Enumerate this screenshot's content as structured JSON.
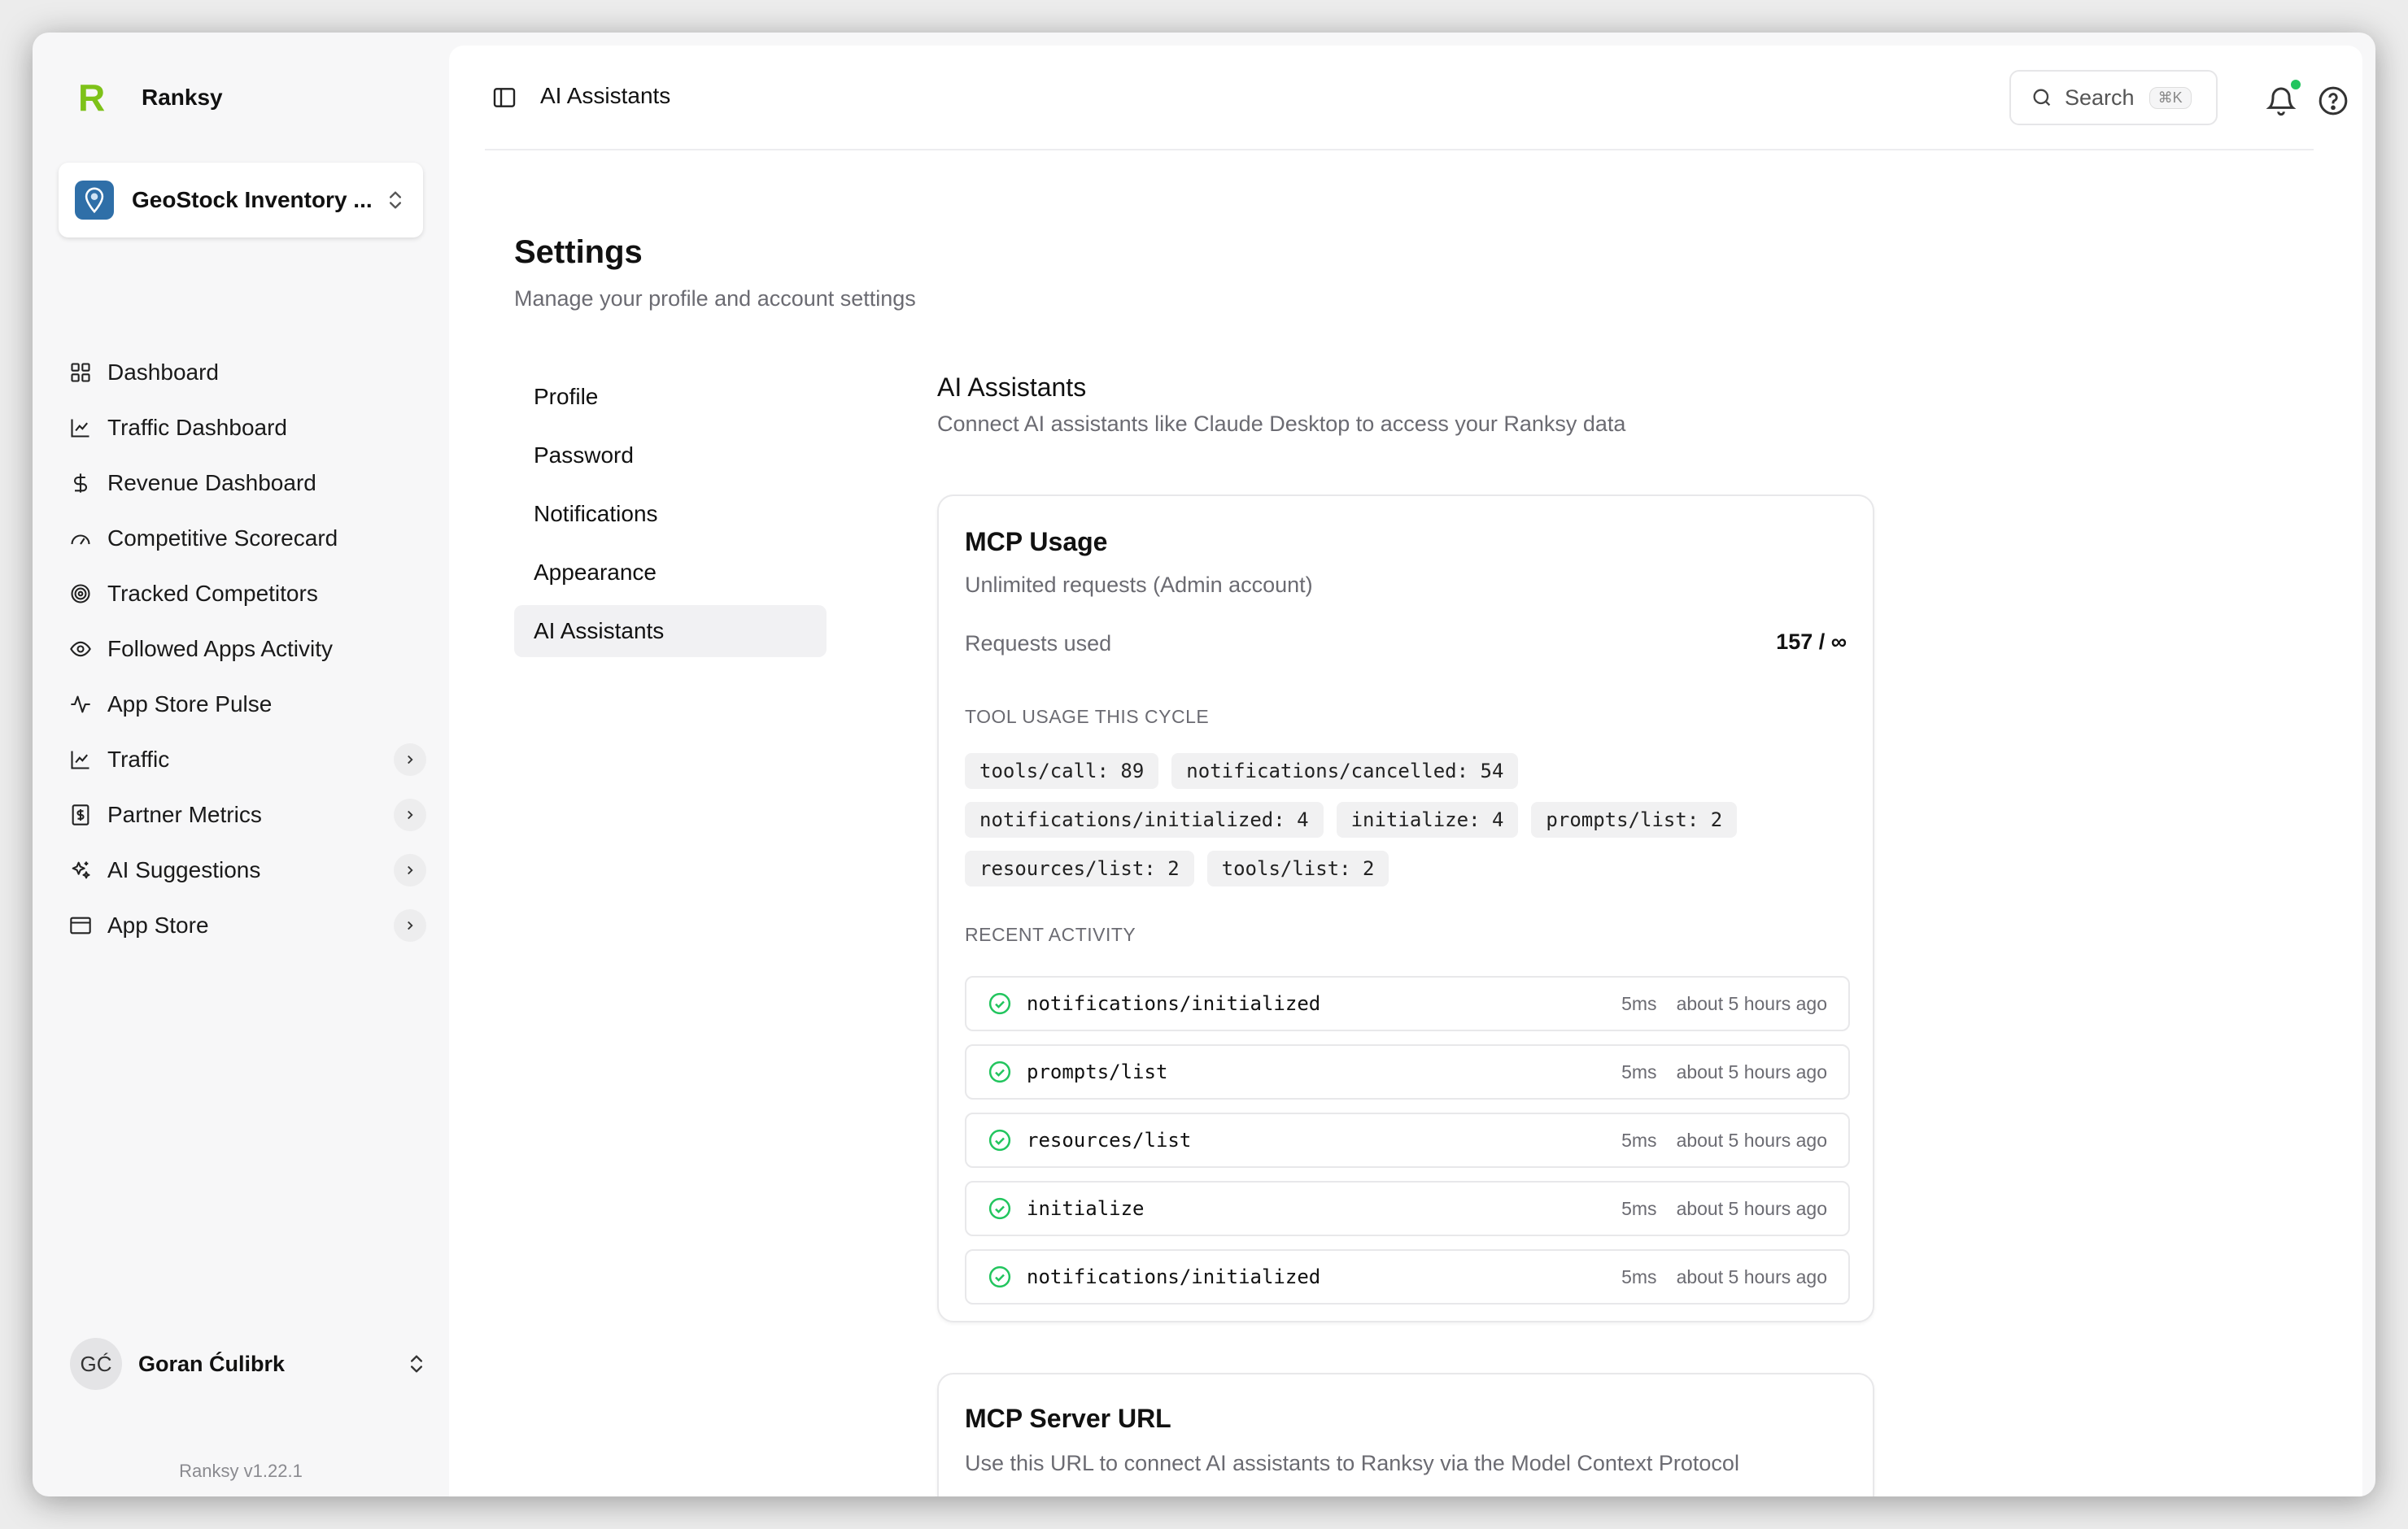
{
  "brand": {
    "name": "Ranksy",
    "logo_letter": "R"
  },
  "workspace": {
    "name": "GeoStock Inventory ..."
  },
  "nav": {
    "items": [
      {
        "label": "Dashboard",
        "icon": "grid-icon"
      },
      {
        "label": "Traffic Dashboard",
        "icon": "line-chart-icon"
      },
      {
        "label": "Revenue Dashboard",
        "icon": "dollar-icon"
      },
      {
        "label": "Competitive Scorecard",
        "icon": "gauge-icon"
      },
      {
        "label": "Tracked Competitors",
        "icon": "target-icon"
      },
      {
        "label": "Followed Apps Activity",
        "icon": "eye-icon"
      },
      {
        "label": "App Store Pulse",
        "icon": "pulse-icon"
      },
      {
        "label": "Traffic",
        "icon": "line-chart-icon",
        "expandable": true
      },
      {
        "label": "Partner Metrics",
        "icon": "dollar-square-icon",
        "expandable": true
      },
      {
        "label": "AI Suggestions",
        "icon": "sparkles-icon",
        "expandable": true
      },
      {
        "label": "App Store",
        "icon": "browser-icon",
        "expandable": true
      }
    ]
  },
  "user": {
    "initials": "GĆ",
    "name": "Goran Ćulibrk"
  },
  "version": "Ranksy  v1.22.1",
  "topbar": {
    "title": "AI Assistants",
    "search_label": "Search",
    "search_shortcut": "⌘K"
  },
  "page": {
    "title": "Settings",
    "subtitle": "Manage your profile and account settings"
  },
  "settings_nav": {
    "items": [
      "Profile",
      "Password",
      "Notifications",
      "Appearance",
      "AI Assistants"
    ],
    "active": "AI Assistants"
  },
  "section": {
    "title": "AI Assistants",
    "subtitle": "Connect AI assistants like Claude Desktop to access your Ranksy data"
  },
  "usage": {
    "title": "MCP Usage",
    "subtitle": "Unlimited requests (Admin account)",
    "requests_label": "Requests used",
    "requests_value": "157 / ∞",
    "tool_usage_heading": "TOOL USAGE THIS CYCLE",
    "tool_usage": [
      "tools/call: 89",
      "notifications/cancelled: 54",
      "notifications/initialized: 4",
      "initialize: 4",
      "prompts/list: 2",
      "resources/list: 2",
      "tools/list: 2"
    ],
    "recent_heading": "RECENT ACTIVITY",
    "recent": [
      {
        "method": "notifications/initialized",
        "duration": "5ms",
        "time": "about 5 hours ago"
      },
      {
        "method": "prompts/list",
        "duration": "5ms",
        "time": "about 5 hours ago"
      },
      {
        "method": "resources/list",
        "duration": "5ms",
        "time": "about 5 hours ago"
      },
      {
        "method": "initialize",
        "duration": "5ms",
        "time": "about 5 hours ago"
      },
      {
        "method": "notifications/initialized",
        "duration": "5ms",
        "time": "about 5 hours ago"
      }
    ]
  },
  "server": {
    "title": "MCP Server URL",
    "subtitle": "Use this URL to connect AI assistants to Ranksy via the Model Context Protocol"
  },
  "colors": {
    "accent": "#7ec219",
    "success": "#22c55e",
    "workspace_icon": "#2f6fa8"
  }
}
